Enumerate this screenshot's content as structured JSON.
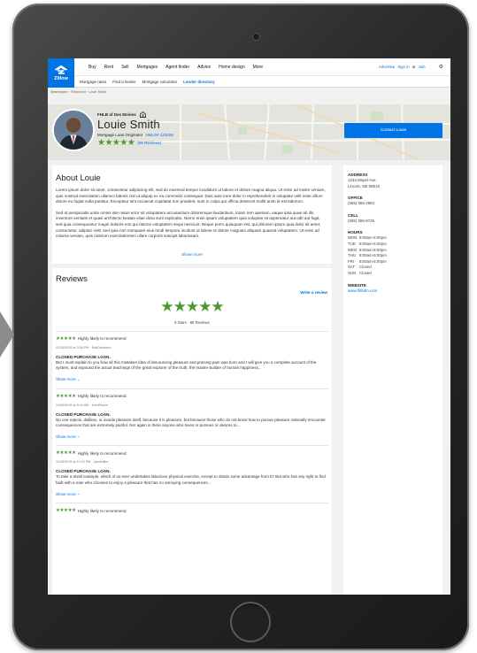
{
  "nav": {
    "logo_text": "Zillow",
    "links": [
      "Buy",
      "Rent",
      "Sell",
      "Mortgages",
      "Agent finder",
      "Advice",
      "Home design",
      "More"
    ],
    "advertise": "Advertise",
    "sign_in": "Sign in",
    "or": "or",
    "join": "Join",
    "sub_links": [
      "Mortgage rates",
      "Find a lender",
      "Mortgage calculator",
      "Lender directory"
    ],
    "active_sub": "Lender directory"
  },
  "breadcrumb": "Washington · Redmond · Louie Smith",
  "profile": {
    "company": "FHLB of Des Moines",
    "name": "Louie Smith",
    "title": "Mortgage Loan Originator",
    "nmls": "NMLS# 123456",
    "stars": "★★★★★",
    "reviews_link": "(85 Reviews)",
    "contact_label": "Contact Louie"
  },
  "about": {
    "heading": "About Louie",
    "para1": "Lorem ipsum dolor sit amet, consectetur adipiscing elit, sed do eiusmod tempor incididunt ut labore et dolore magna aliqua. Ut enim ad minim veniam, quis nostrud exercitation ullamco laboris nisi ut aliquip ex ea commodo consequat. Duis aute irure dolor in reprehenderit in voluptate velit esse cillum dolore eu fugiat nulla pariatur. Excepteur sint occaecat cupidatat non proident, sunt in culpa qui officia deserunt mollit anim id est laborum.",
    "para2": "Sed ut perspiciatis unde omnis iste natus error sit voluptatem accusantium doloremque laudantium, totam rem aperiam, eaque ipsa quae ab illo inventore veritatis et quasi architecto beatae vitae dicta sunt explicabo. Nemo enim ipsam voluptatem quia voluptas sit aspernatur aut odit aut fugit, sed quia consequuntur magni dolores eos qui ratione voluptatem sequi nesciunt. Neque porro quisquam est, qui dolorem ipsum quia dolor sit amet, consectetur, adipisci velit, sed quia non numquam eius modi tempora incidunt ut labore et dolore magnam aliquam quaerat voluptatem. Ut enim ad minima veniam, quis nostrum exercitationem ullam corporis suscipit laboriosam.",
    "show_more": "Show more"
  },
  "reviews": {
    "heading": "Reviews",
    "write_review": "Write a review",
    "summary_stars": "★★★★★",
    "summary_text": "5 Stars · 85 Reviews",
    "items": [
      {
        "stars": "★★★★★",
        "recommend": "Highly likely to recommend",
        "date": "01/10/2016 at 3:56 PM · BobDavidson",
        "title": "CLOSED PURCHASE LOAN.",
        "body": "But I must explain to you how all this mistaken idea of denouncing pleasure and praising pain was born and I will give you a complete account of the system, and expound the actual teachings of the great explorer of the truth, the master-builder of human happiness...",
        "more": "Show more"
      },
      {
        "stars": "★★★★★",
        "recommend": "Highly likely to recommend",
        "date": "01/04/2016 at 8:44 AM · JohnBrown",
        "title": "CLOSED PURCHASE LOAN.",
        "body": "No one rejects, dislikes, or avoids pleasure itself, because it is pleasure, but because those who do not know how to pursue pleasure rationally encounter consequences that are extremely painful. Nor again is there anyone who loves or pursues or desires to...",
        "more": "Show more"
      },
      {
        "stars": "★★★★★",
        "recommend": "Highly likely to recommend",
        "date": "12/26/2015 at 12:19 PM · JaneMiller",
        "title": "CLOSED PURCHASE LOAN.",
        "body": "To take a trivial example, which of us ever undertakes laborious physical exercise, except to obtain some advantage from it? But who has any right to find fault with a man who chooses to enjoy a pleasure that has no annoying consequences...",
        "more": "Show more"
      },
      {
        "stars": "★★★★★",
        "recommend": "Highly likely to recommend"
      }
    ]
  },
  "sidebar": {
    "address_label": "ADDRESS",
    "address_line1": "1234 Mapel Ave.",
    "address_line2": "Lincoln, NE 68516",
    "office_label": "OFFICE",
    "office": "(555) 555-2984",
    "cell_label": "CELL",
    "cell": "(555) 555-8735",
    "hours_label": "HOURS",
    "hours": [
      {
        "day": "MON",
        "time": "8:00am-5:00pm"
      },
      {
        "day": "TUE",
        "time": "8:00am-5:00pm"
      },
      {
        "day": "WED",
        "time": "8:00am-5:00pm"
      },
      {
        "day": "THU",
        "time": "8:00am-5:00pm"
      },
      {
        "day": "FRI",
        "time": "8:00am-5:00pm"
      },
      {
        "day": "SAT",
        "time": "Closed"
      },
      {
        "day": "SUN",
        "time": "Closed"
      }
    ],
    "website_label": "WEBSITE",
    "website": "www.fhlbdm.com"
  },
  "colors": {
    "brand": "#0074e4",
    "star": "#4a9a2f"
  }
}
